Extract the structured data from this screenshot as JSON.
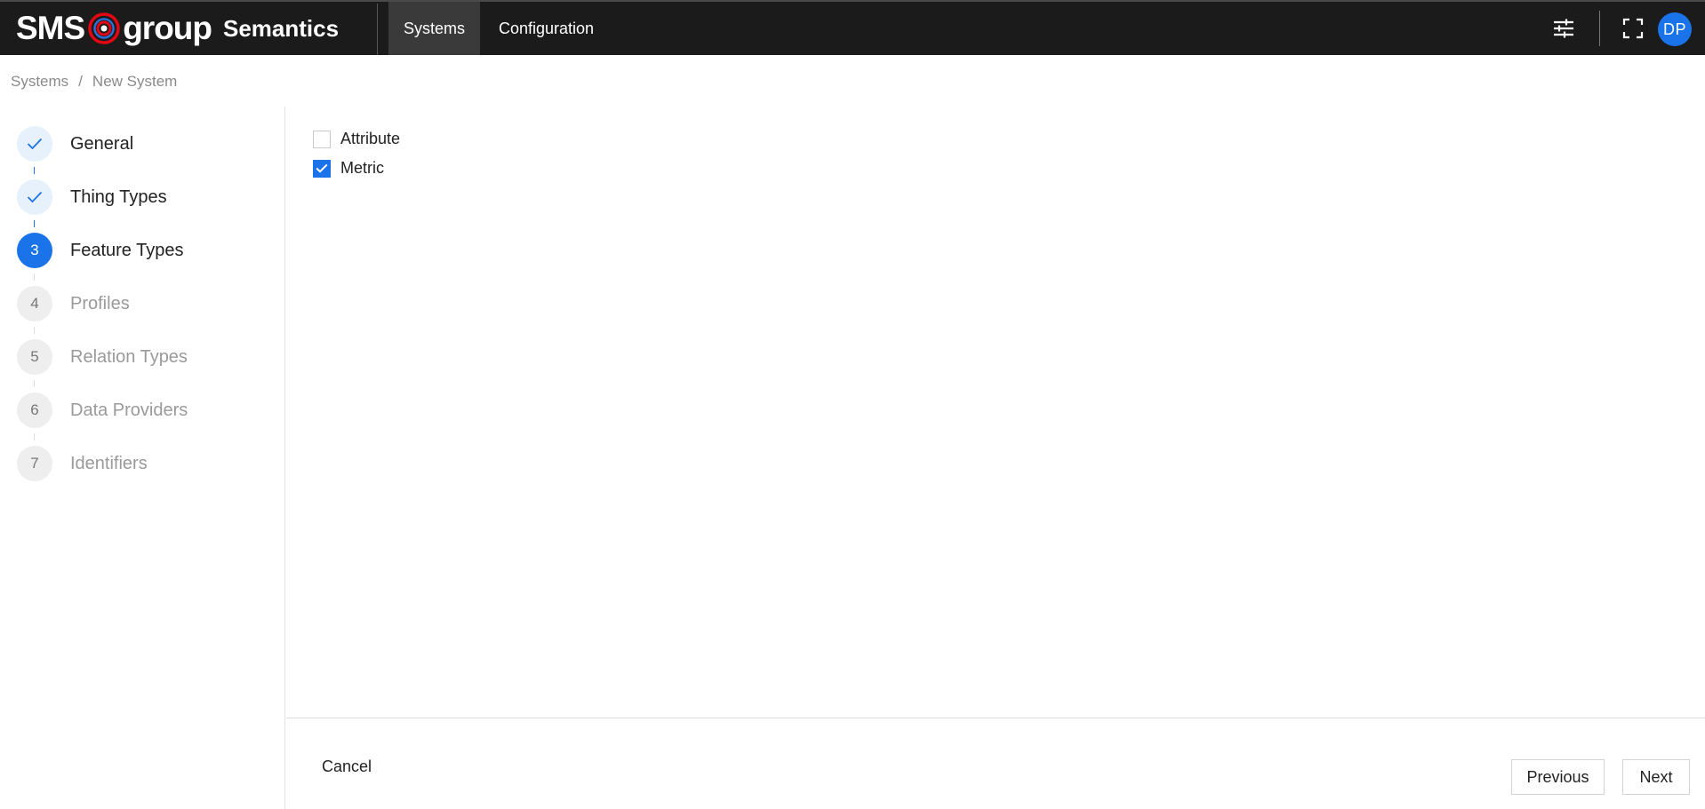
{
  "header": {
    "logo_text_left": "SMS",
    "logo_text_right": "group",
    "product_name": "Semantics",
    "nav_tabs": [
      {
        "label": "Systems",
        "active": true
      },
      {
        "label": "Configuration",
        "active": false
      }
    ],
    "settings_icon": "sliders-icon",
    "fullscreen_icon": "fullscreen-icon",
    "avatar_initials": "DP"
  },
  "breadcrumb": {
    "items": [
      "Systems",
      "New System"
    ],
    "separator": "/"
  },
  "stepper": {
    "steps": [
      {
        "number": "1",
        "label": "General",
        "state": "done"
      },
      {
        "number": "2",
        "label": "Thing Types",
        "state": "done"
      },
      {
        "number": "3",
        "label": "Feature Types",
        "state": "active"
      },
      {
        "number": "4",
        "label": "Profiles",
        "state": "pending"
      },
      {
        "number": "5",
        "label": "Relation Types",
        "state": "pending"
      },
      {
        "number": "6",
        "label": "Data Providers",
        "state": "pending"
      },
      {
        "number": "7",
        "label": "Identifiers",
        "state": "pending"
      }
    ]
  },
  "feature_types": {
    "options": [
      {
        "label": "Attribute",
        "checked": false
      },
      {
        "label": "Metric",
        "checked": true
      }
    ]
  },
  "footer": {
    "cancel_label": "Cancel",
    "previous_label": "Previous",
    "next_label": "Next"
  },
  "colors": {
    "header_bg": "#1b1b1b",
    "accent": "#1a73e8",
    "logo_red": "#e30613"
  }
}
